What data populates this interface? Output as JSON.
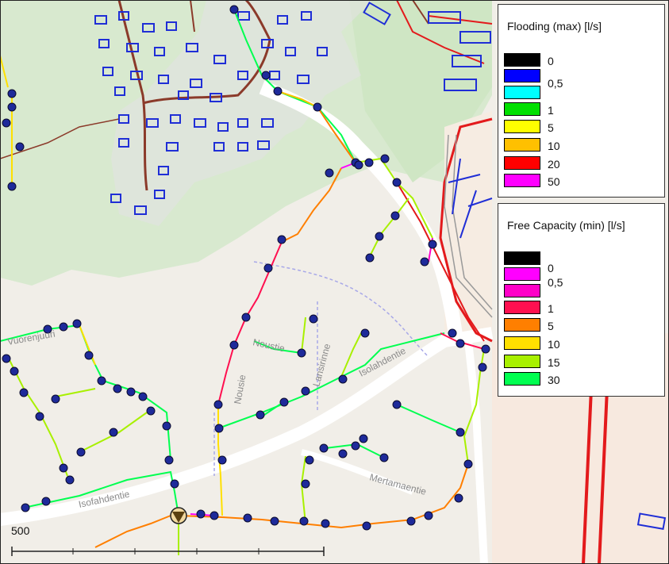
{
  "map": {
    "street_labels": [
      {
        "text": "Vuorenjuuri"
      },
      {
        "text": "Isofahdentie"
      },
      {
        "text": "Isolahdentie"
      },
      {
        "text": "Mertamaentie"
      },
      {
        "text": "Lansirinne"
      },
      {
        "text": "Noustie"
      },
      {
        "text": "Nousie"
      }
    ],
    "colors": {
      "background": "#f2efe9",
      "forest": "#d9ead0",
      "road": "#ffffff",
      "building_outline": "#1f2ed6",
      "node_fill": "#1e2a9a",
      "node_stroke": "#0b0b2e",
      "red_pipe": "#e31a1c",
      "brown_path": "#8b3a2a"
    },
    "outlet_icon": "triangle-outlet-icon"
  },
  "legend_flooding": {
    "title": "Flooding (max) [l/s]",
    "items": [
      {
        "label": "0",
        "color": "#000000"
      },
      {
        "label": "0,5",
        "color": "#0000ff"
      },
      {
        "label": "",
        "color": "#00ffff"
      },
      {
        "label": "1",
        "color": "#00e000"
      },
      {
        "label": "5",
        "color": "#ffff00"
      },
      {
        "label": "10",
        "color": "#ffc000"
      },
      {
        "label": "20",
        "color": "#ff0000"
      },
      {
        "label": "50",
        "color": "#ff00ff"
      }
    ]
  },
  "legend_capacity": {
    "title": "Free Capacity (min) [l/s]",
    "items": [
      {
        "label": "0",
        "color": "#000000"
      },
      {
        "label": "",
        "color": "#ff00ff"
      },
      {
        "label": "0,5",
        "color": "#ff00c8"
      },
      {
        "label": "1",
        "color": "#ff1050"
      },
      {
        "label": "5",
        "color": "#ff7f00"
      },
      {
        "label": "10",
        "color": "#ffe000"
      },
      {
        "label": "15",
        "color": "#a8f000"
      },
      {
        "label": "30",
        "color": "#00ff50"
      }
    ]
  },
  "scale": {
    "label": "500"
  }
}
